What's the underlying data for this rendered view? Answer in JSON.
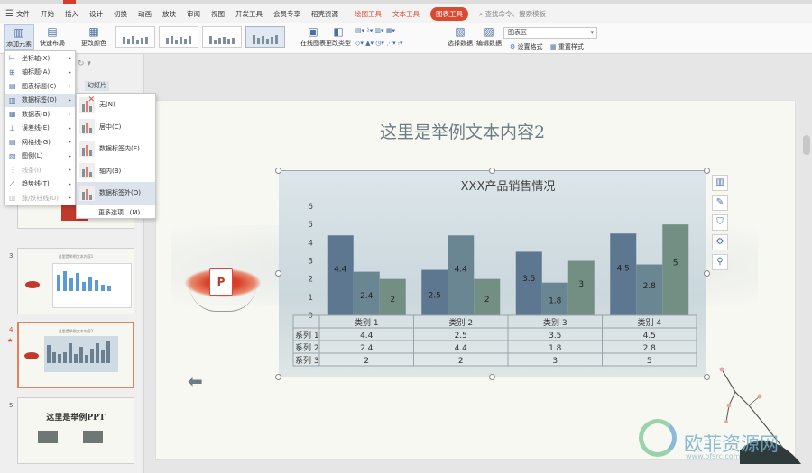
{
  "menubar": {
    "items": [
      "文件",
      "开始",
      "插入",
      "设计",
      "切换",
      "动画",
      "放映",
      "审阅",
      "视图",
      "开发工具",
      "会员专享",
      "稻壳资源"
    ],
    "context_tabs": [
      "绘图工具",
      "文本工具"
    ],
    "active_tab": "图表工具",
    "search": "查找命令、搜索模板"
  },
  "ribbon": {
    "add_element": "添加元素",
    "quick_layout": "快速布局",
    "change_color": "更改颜色",
    "online_chart": "在线图表",
    "change_type": "更改类型",
    "select_data": "选择数据",
    "edit_data": "编辑数据",
    "area_select": "图表区",
    "set_format": "设置格式",
    "reset_style": "重置样式"
  },
  "left_panel": {
    "slides_button": "幻灯片",
    "thumb3_title": "这里是举例文本内容1",
    "thumb4_title": "这里是举例文本内容2",
    "thumb5_title": "这里是举例PPT",
    "slide_numbers": [
      "3",
      "4",
      "5"
    ],
    "star": "★"
  },
  "menu_add_element": {
    "items": [
      {
        "label": "坐标轴(X)",
        "disabled": false
      },
      {
        "label": "轴标题(A)",
        "disabled": false
      },
      {
        "label": "图表标题(C)",
        "disabled": false
      },
      {
        "label": "数据标签(D)",
        "disabled": false
      },
      {
        "label": "数据表(B)",
        "disabled": false
      },
      {
        "label": "误差线(E)",
        "disabled": false
      },
      {
        "label": "网格线(G)",
        "disabled": false
      },
      {
        "label": "图例(L)",
        "disabled": false
      },
      {
        "label": "线条(I)",
        "disabled": true
      },
      {
        "label": "趋势线(T)",
        "disabled": false
      },
      {
        "label": "涨/跌柱线(U)",
        "disabled": true
      }
    ]
  },
  "menu_data_labels": {
    "items": [
      "无(N)",
      "居中(C)",
      "数据标签内(E)",
      "轴内(B)",
      "数据标签外(O)"
    ],
    "more": "更多选项...(M)"
  },
  "slide": {
    "title": "这里是举例文本内容2",
    "ppt_letter": "P"
  },
  "chart_data": {
    "type": "bar",
    "title": "XXX产品销售情况",
    "categories": [
      "类别 1",
      "类别 2",
      "类别 3",
      "类别 4"
    ],
    "series": [
      {
        "name": "系列 1",
        "values": [
          4.4,
          2.5,
          3.5,
          4.5
        ],
        "color": "#5d7790"
      },
      {
        "name": "系列 2",
        "values": [
          2.4,
          4.4,
          1.8,
          2.8
        ],
        "color": "#6b8693"
      },
      {
        "name": "系列 3",
        "values": [
          2,
          2,
          3,
          5
        ],
        "color": "#738f84"
      }
    ],
    "ylim": [
      0,
      6
    ],
    "yticks": [
      "0",
      "1",
      "2",
      "3",
      "4",
      "5",
      "6"
    ],
    "data_table": true,
    "gridlines": false
  },
  "watermark": {
    "text": "欧菲资源网",
    "url": "www.ofsrc.com"
  }
}
